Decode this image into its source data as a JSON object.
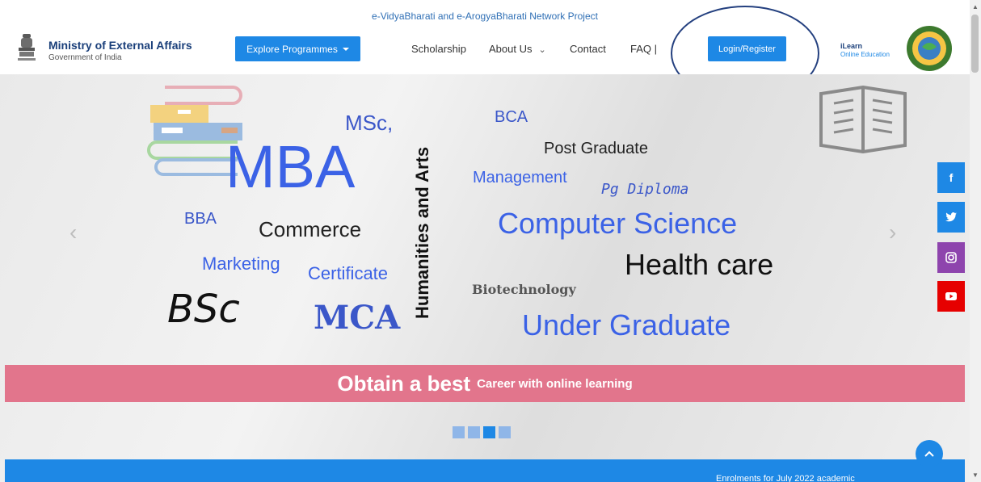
{
  "header": {
    "top_caption": "e-VidyaBharati and e-ArogyaBharati Network Project",
    "brand_title": "Ministry of External Affairs",
    "brand_subtitle": "Government of India",
    "explore_label": "Explore Programmes",
    "nav": {
      "scholarship": "Scholarship",
      "about": "About Us",
      "contact": "Contact",
      "faq": "FAQ |"
    },
    "login_label": "Login/Register",
    "ilearn_title": "iLearn",
    "ilearn_subtitle": "Online Education"
  },
  "hero": {
    "words": {
      "msc": "MSc,",
      "mba": "MBA",
      "bba": "BBA",
      "commerce": "Commerce",
      "marketing": "Marketing",
      "certificate": "Certificate",
      "bsc": "BSc",
      "mca": "MCA",
      "humanities": "Humanities and Arts",
      "bca": "BCA",
      "post_graduate": "Post Graduate",
      "management": "Management",
      "pg_diploma": "Pg Diploma",
      "computer_science": "Computer Science",
      "health_care": "Health care",
      "biotechnology": "Biotechnology",
      "under_graduate": "Under Graduate"
    },
    "banner_big": "Obtain a best",
    "banner_small": "Career with online learning",
    "slides": {
      "count": 4,
      "active_index": 2
    }
  },
  "social": {
    "facebook": "f",
    "twitter": "twitter-icon",
    "instagram": "instagram-icon",
    "youtube": "youtube-icon"
  },
  "footer": {
    "enrolment_text": "Enrolments for July 2022 academic"
  },
  "colors": {
    "primary_blue": "#1e88e5",
    "banner_pink": "#e2758c",
    "facebook": "#1e88e5",
    "twitter": "#1e88e5",
    "instagram": "#8e44ad",
    "youtube": "#e60000"
  }
}
